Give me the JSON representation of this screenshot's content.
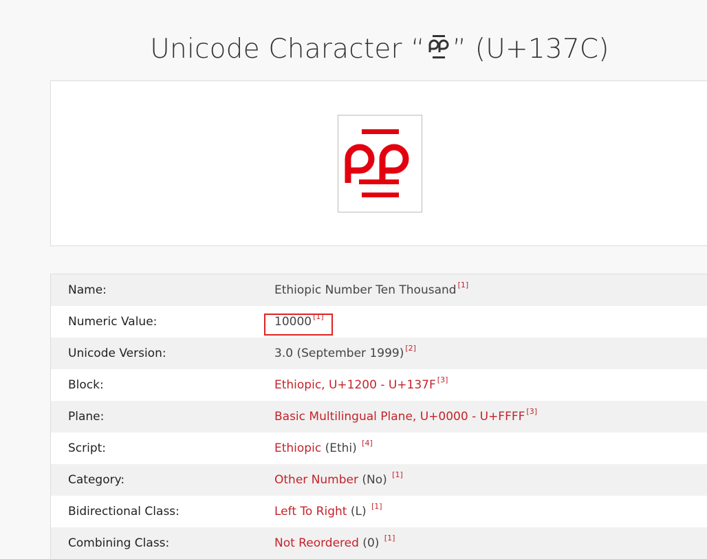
{
  "page": {
    "title_prefix": "Unicode Character “",
    "title_char": "፼",
    "title_suffix": "” (U+137C)"
  },
  "colors": {
    "accent": "#c4232a",
    "glyph": "#e3000f",
    "highlight": "#e02020"
  },
  "properties": [
    {
      "label": "Name:",
      "value": "Ethiopic Number Ten Thousand",
      "value_is_link": false,
      "extra": "",
      "ref": "[1]"
    },
    {
      "label": "Numeric Value:",
      "value": "10000",
      "value_is_link": false,
      "extra": "",
      "ref": "[1]"
    },
    {
      "label": "Unicode Version:",
      "value": "3.0 (September 1999)",
      "value_is_link": false,
      "extra": "",
      "ref": "[2]"
    },
    {
      "label": "Block:",
      "value": "Ethiopic, U+1200 - U+137F",
      "value_is_link": true,
      "extra": "",
      "ref": "[3]"
    },
    {
      "label": "Plane:",
      "value": "Basic Multilingual Plane, U+0000 - U+FFFF",
      "value_is_link": true,
      "extra": "",
      "ref": "[3]"
    },
    {
      "label": "Script:",
      "value": "Ethiopic",
      "value_is_link": true,
      "extra": " (Ethi) ",
      "ref": "[4]"
    },
    {
      "label": "Category:",
      "value": "Other Number",
      "value_is_link": true,
      "extra": " (No) ",
      "ref": "[1]"
    },
    {
      "label": "Bidirectional Class:",
      "value": "Left To Right",
      "value_is_link": true,
      "extra": " (L) ",
      "ref": "[1]"
    },
    {
      "label": "Combining Class:",
      "value": "Not Reordered",
      "value_is_link": true,
      "extra": " (0) ",
      "ref": "[1]"
    }
  ]
}
